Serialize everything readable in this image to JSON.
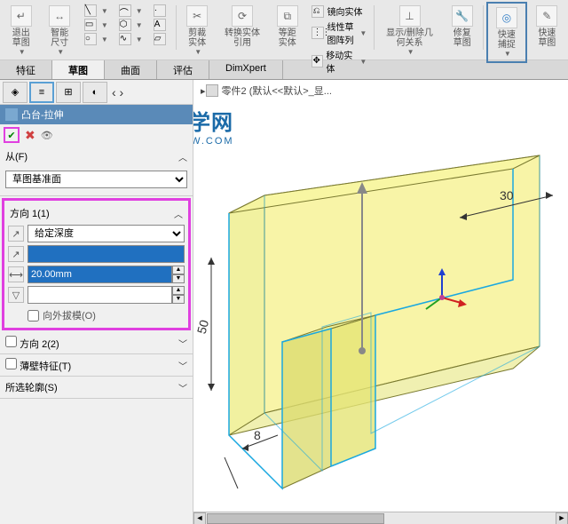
{
  "ribbon": {
    "exit_sketch": "退出草图",
    "smart_dim": "智能尺寸",
    "trim_entities": "剪裁实体",
    "convert_entities": "转换实体引用",
    "offset_entities": "等距实体",
    "mirror_entities": "镜向实体",
    "linear_pattern": "线性草图阵列",
    "move_entities": "移动实体",
    "display_delete": "显示/删除几何关系",
    "repair_sketch": "修复草图",
    "quick_snap": "快速捕捉",
    "quick_sketch": "快速草图"
  },
  "tabs": {
    "features": "特征",
    "sketch": "草图",
    "surfaces": "曲面",
    "evaluate": "评估",
    "dimxpert": "DimXpert"
  },
  "feature": {
    "title": "凸台-拉伸"
  },
  "from_section": {
    "label": "从(F)",
    "value": "草图基准面"
  },
  "direction1": {
    "label": "方向 1(1)",
    "end_condition": "给定深度",
    "depth_value": "20.00mm",
    "outward_draft": "向外拔模(O)"
  },
  "direction2": {
    "label": "方向 2(2)"
  },
  "thin_feature": {
    "label": "薄壁特征(T)"
  },
  "selected_contours": {
    "label": "所选轮廓(S)"
  },
  "breadcrumb": {
    "text": "零件2  (默认<<默认>_显..."
  },
  "watermark": {
    "main": "软件自学网",
    "sub": "WWW.RJZXW.COM"
  },
  "dimensions": {
    "d1": "30",
    "d2": "50",
    "d3": "8"
  }
}
